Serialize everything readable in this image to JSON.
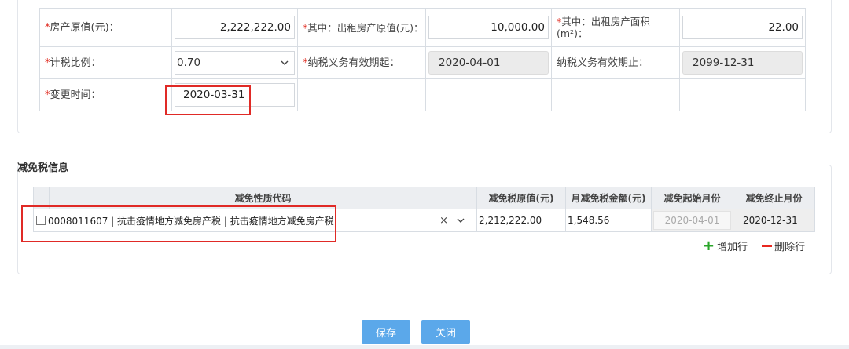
{
  "form": {
    "row1": {
      "original_value_label": "房产原值(元)：",
      "original_value": "2,222,222.00",
      "rent_value_label": "其中：出租房产原值(元)：",
      "rent_value": "10,000.00",
      "rent_area_label": "其中：出租房产面积(m²)：",
      "rent_area": "22.00"
    },
    "row2": {
      "tax_ratio_label": "计税比例：",
      "tax_ratio": "0.70",
      "obligation_start_label": "纳税义务有效期起：",
      "obligation_start": "2020-04-01",
      "obligation_end_label": "纳税义务有效期止：",
      "obligation_end": "2099-12-31"
    },
    "row3": {
      "change_time_label": "变更时间：",
      "change_time": "2020-03-31"
    },
    "required_mark": "*"
  },
  "relief": {
    "section_title": "减免税信息",
    "columns": [
      "减免性质代码",
      "减免税原值(元)",
      "月减免税金额(元)",
      "减免起始月份",
      "减免终止月份"
    ],
    "rows": [
      {
        "code": "0008011607 | 抗击疫情地方减免房产税 | 抗击疫情地方减免房产税",
        "original_value": "2,212,222.00",
        "monthly_amount": "1,548.56",
        "start_month": "2020-04-01",
        "end_month": "2020-12-31"
      }
    ],
    "clear_glyph": "×",
    "add_row_label": "增加行",
    "delete_row_label": "删除行"
  },
  "buttons": {
    "save_label": "保存",
    "close_label": "关闭"
  },
  "colors": {
    "required": "#e0281d",
    "highlight_frame": "#e02a26",
    "primary_button": "#5ba8ea",
    "add_icon": "#2aa52a",
    "delete_icon": "#e8271f"
  },
  "icons": [
    "chevron-down-icon",
    "clear-icon",
    "plus-icon",
    "minus-icon",
    "checkbox"
  ]
}
